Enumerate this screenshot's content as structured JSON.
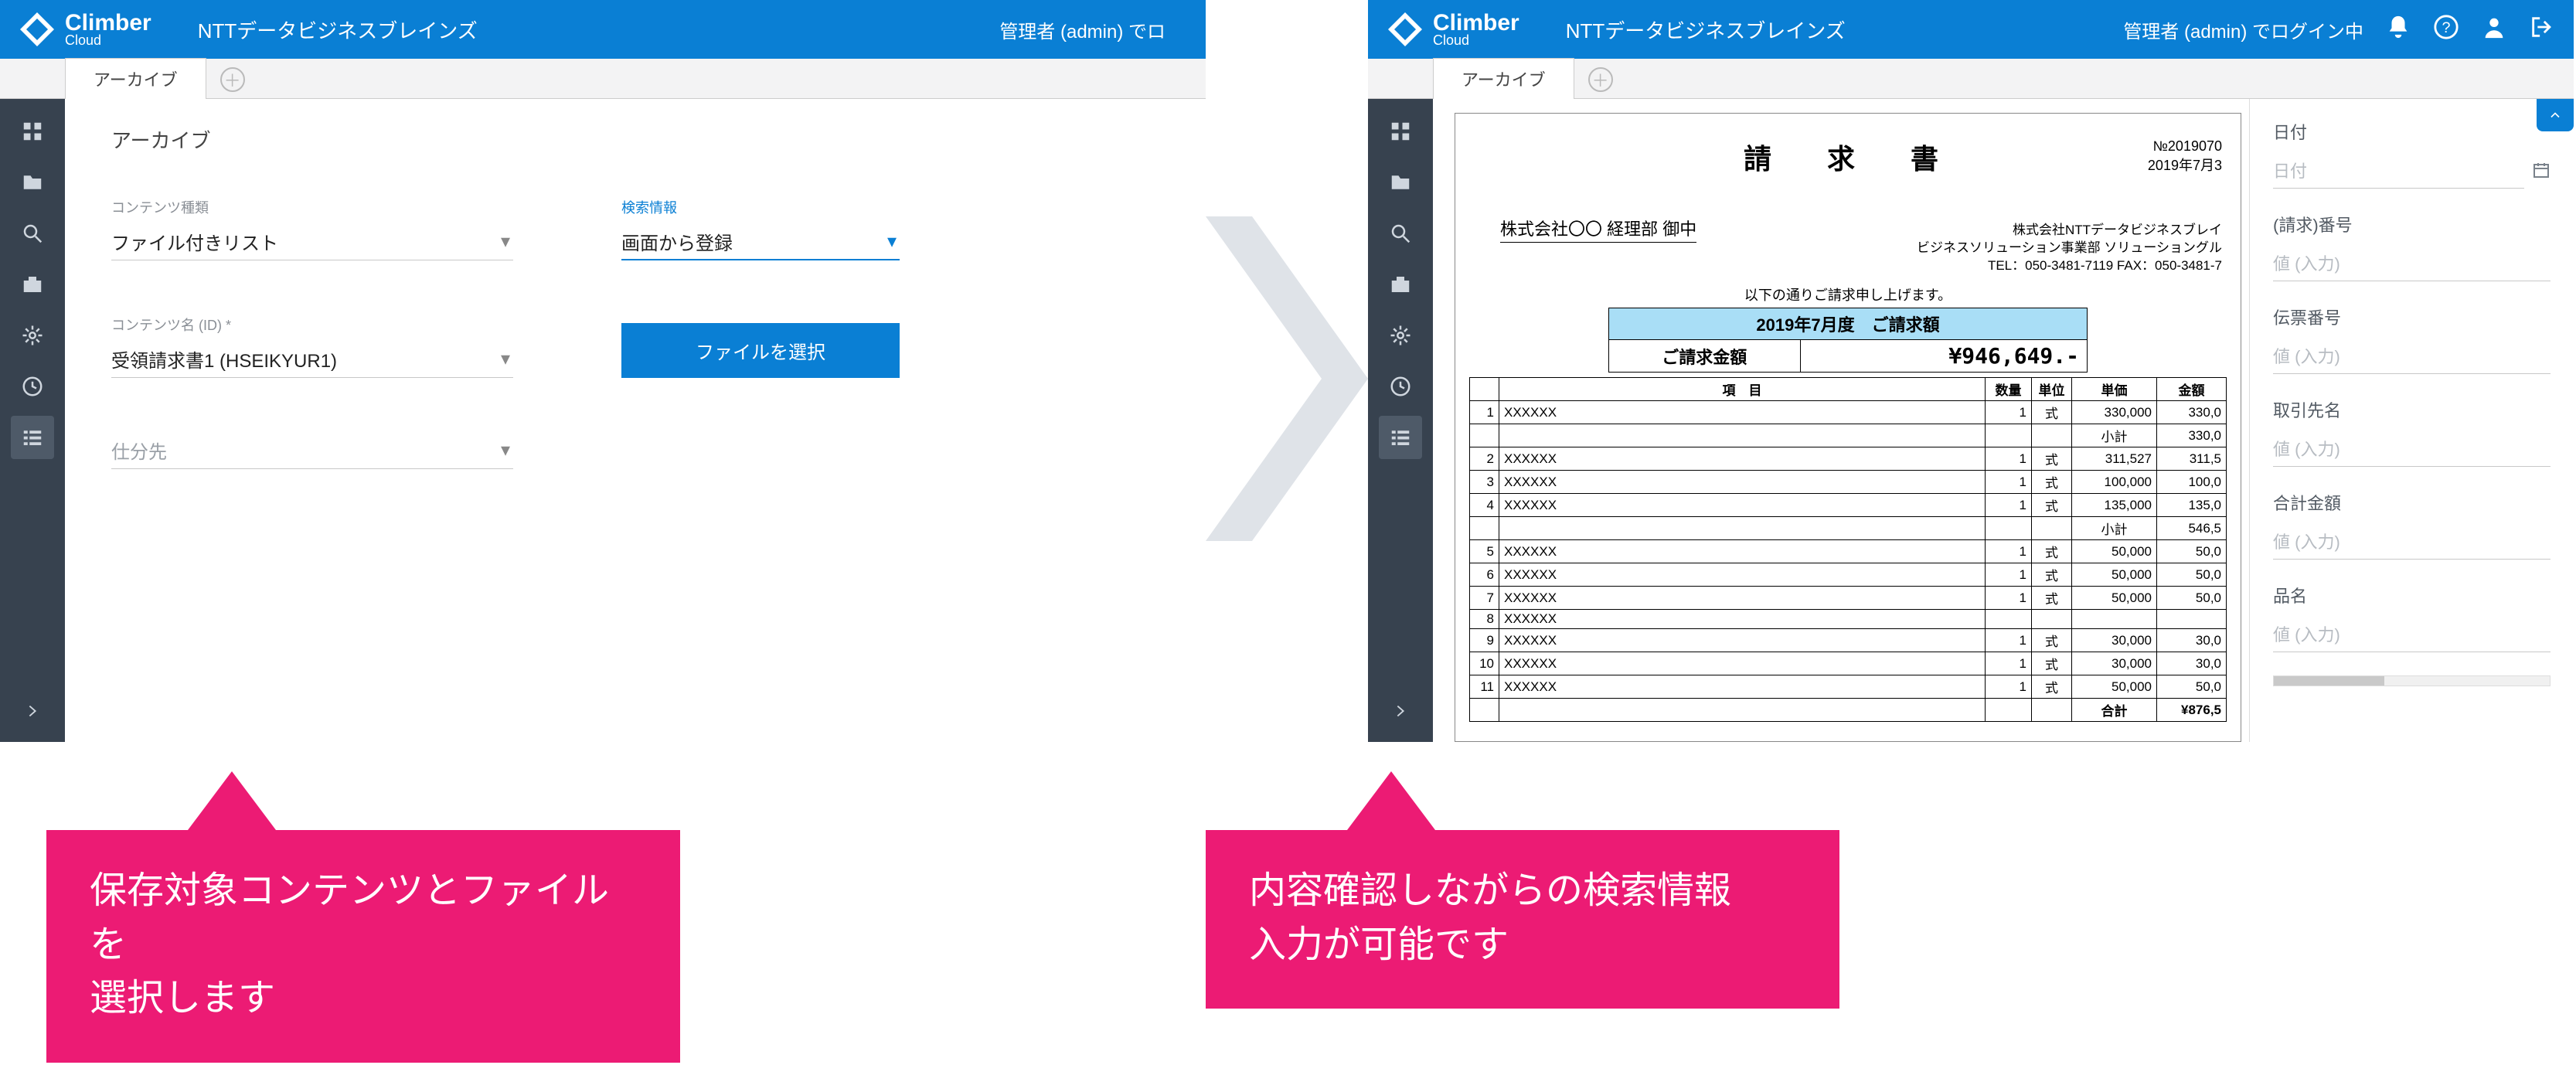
{
  "brand": {
    "name": "Climber",
    "sub": "Cloud"
  },
  "org": "NTTデータビジネスブレインズ",
  "login_left": "管理者 (admin) でロ",
  "login_right": "管理者 (admin) でログイン中",
  "tab_label": "アーカイブ",
  "left_form": {
    "title": "アーカイブ",
    "content_type_label": "コンテンツ種類",
    "content_type_value": "ファイル付きリスト",
    "search_info_label": "検索情報",
    "search_info_value": "画面から登録",
    "content_name_label": "コンテンツ名 (ID) *",
    "content_name_value": "受領請求書1 (HSEIKYUR1)",
    "select_file_btn": "ファイルを選択",
    "sort_dest_label": "仕分先"
  },
  "doc": {
    "title": "請　求　書",
    "number": "№2019070",
    "date": "2019年7月3",
    "addressee": "株式会社〇〇  経理部  御中",
    "sender1": "株式会社NTTデータビジネスブレイ",
    "sender2": "ビジネスソリューション事業部  ソリューショングル",
    "sender3": "TEL：050-3481-7119 FAX：050-3481-7",
    "intro": "以下の通りご請求申し上げます。",
    "period_hdr": "2019年7月度　ご請求額",
    "amount_label": "ご請求金額",
    "amount_value": "¥946,649.-",
    "cols": {
      "item": "項　目",
      "qty": "数量",
      "unit": "単位",
      "price": "単価",
      "amount": "金額"
    },
    "rows": [
      {
        "n": "1",
        "name": "XXXXXX",
        "qty": "1",
        "unit": "式",
        "price": "330,000",
        "amount": "330,0"
      },
      {
        "subtotal": true,
        "label": "小計",
        "amount": "330,0"
      },
      {
        "n": "2",
        "name": "XXXXXX",
        "qty": "1",
        "unit": "式",
        "price": "311,527",
        "amount": "311,5"
      },
      {
        "n": "3",
        "name": "XXXXXX",
        "qty": "1",
        "unit": "式",
        "price": "100,000",
        "amount": "100,0"
      },
      {
        "n": "4",
        "name": "XXXXXX",
        "qty": "1",
        "unit": "式",
        "price": "135,000",
        "amount": "135,0"
      },
      {
        "subtotal": true,
        "label": "小計",
        "amount": "546,5"
      },
      {
        "n": "5",
        "name": "XXXXXX",
        "qty": "1",
        "unit": "式",
        "price": "50,000",
        "amount": "50,0"
      },
      {
        "n": "6",
        "name": "XXXXXX",
        "qty": "1",
        "unit": "式",
        "price": "50,000",
        "amount": "50,0"
      },
      {
        "n": "7",
        "name": "XXXXXX",
        "qty": "1",
        "unit": "式",
        "price": "50,000",
        "amount": "50,0"
      },
      {
        "n": "8",
        "name": "XXXXXX",
        "qty": "",
        "unit": "",
        "price": "",
        "amount": ""
      },
      {
        "n": "9",
        "name": "XXXXXX",
        "qty": "1",
        "unit": "式",
        "price": "30,000",
        "amount": "30,0"
      },
      {
        "n": "10",
        "name": "XXXXXX",
        "qty": "1",
        "unit": "式",
        "price": "30,000",
        "amount": "30,0"
      },
      {
        "n": "11",
        "name": "XXXXXX",
        "qty": "1",
        "unit": "式",
        "price": "50,000",
        "amount": "50,0"
      },
      {
        "total": true,
        "label": "合計",
        "amount": "¥876,5"
      }
    ]
  },
  "search_pane": {
    "f_date_label": "日付",
    "f_date_ph": "日付",
    "f_reqno_label": "(請求)番号",
    "f_slipno_label": "伝票番号",
    "f_partner_label": "取引先名",
    "f_total_label": "合計金額",
    "f_item_label": "品名",
    "value_ph": "値 (入力)"
  },
  "callout1": "保存対象コンテンツとファイルを\n選択します",
  "callout2": "内容確認しながらの検索情報\n入力が可能です"
}
